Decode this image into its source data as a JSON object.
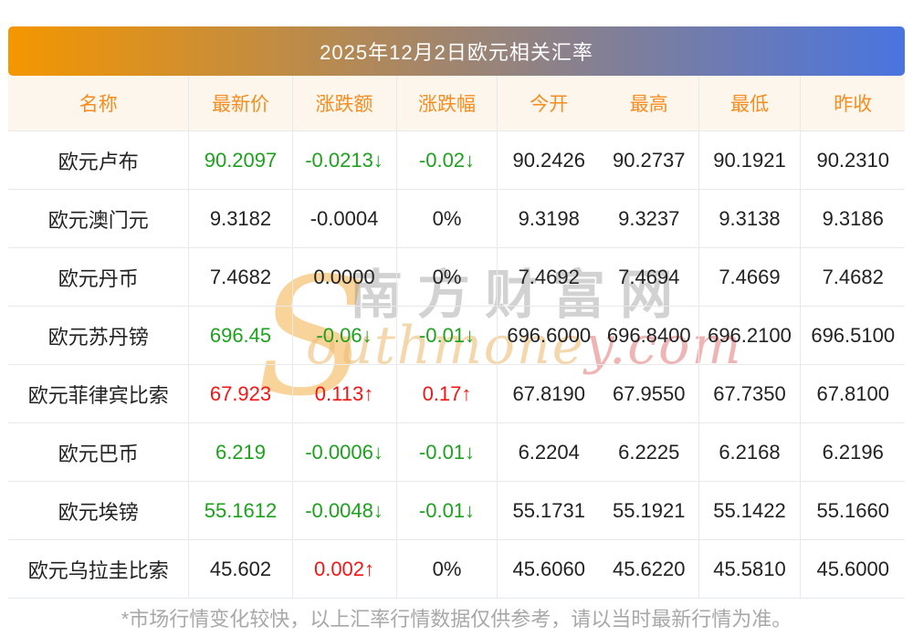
{
  "banner": {
    "title": "2025年12月2日欧元相关汇率"
  },
  "columns": {
    "name": "名称",
    "latest": "最新价",
    "change": "涨跌额",
    "change_pct": "涨跌幅",
    "open": "今开",
    "high": "最高",
    "low": "最低",
    "prev_close": "昨收"
  },
  "rows": [
    {
      "name": "欧元卢布",
      "latest": "90.2097",
      "latest_cls": "down",
      "change": "-0.0213↓",
      "change_cls": "down",
      "pct": "-0.02↓",
      "pct_cls": "down",
      "open": "90.2426",
      "high": "90.2737",
      "low": "90.1921",
      "prev": "90.2310"
    },
    {
      "name": "欧元澳门元",
      "latest": "9.3182",
      "latest_cls": "flat",
      "change": "-0.0004",
      "change_cls": "flat",
      "pct": "0%",
      "pct_cls": "flat",
      "open": "9.3198",
      "high": "9.3237",
      "low": "9.3138",
      "prev": "9.3186"
    },
    {
      "name": "欧元丹币",
      "latest": "7.4682",
      "latest_cls": "flat",
      "change": "0.0000",
      "change_cls": "flat",
      "pct": "0%",
      "pct_cls": "flat",
      "open": "7.4692",
      "high": "7.4694",
      "low": "7.4669",
      "prev": "7.4682"
    },
    {
      "name": "欧元苏丹镑",
      "latest": "696.45",
      "latest_cls": "down",
      "change": "-0.06↓",
      "change_cls": "down",
      "pct": "-0.01↓",
      "pct_cls": "down",
      "open": "696.6000",
      "high": "696.8400",
      "low": "696.2100",
      "prev": "696.5100"
    },
    {
      "name": "欧元菲律宾比索",
      "latest": "67.923",
      "latest_cls": "up",
      "change": "0.113↑",
      "change_cls": "up",
      "pct": "0.17↑",
      "pct_cls": "up",
      "open": "67.8190",
      "high": "67.9550",
      "low": "67.7350",
      "prev": "67.8100"
    },
    {
      "name": "欧元巴币",
      "latest": "6.219",
      "latest_cls": "down",
      "change": "-0.0006↓",
      "change_cls": "down",
      "pct": "-0.01↓",
      "pct_cls": "down",
      "open": "6.2204",
      "high": "6.2225",
      "low": "6.2168",
      "prev": "6.2196"
    },
    {
      "name": "欧元埃镑",
      "latest": "55.1612",
      "latest_cls": "down",
      "change": "-0.0048↓",
      "change_cls": "down",
      "pct": "-0.01↓",
      "pct_cls": "down",
      "open": "55.1731",
      "high": "55.1921",
      "low": "55.1422",
      "prev": "55.1660"
    },
    {
      "name": "欧元乌拉圭比索",
      "latest": "45.602",
      "latest_cls": "flat",
      "change": "0.002↑",
      "change_cls": "up",
      "pct": "0%",
      "pct_cls": "flat",
      "open": "45.6060",
      "high": "45.6220",
      "low": "45.5810",
      "prev": "45.6000"
    }
  ],
  "watermark": {
    "s": "S",
    "cn": "南方财富网",
    "en_a": "outhmone",
    "en_b": "y.com"
  },
  "footer": {
    "disclaimer": "*市场行情变化较快，以上汇率行情数据仅供参考，请以当时最新行情为准。"
  },
  "colors": {
    "banner_gradient_left": "#f49600",
    "banner_gradient_right": "#4a74e0",
    "header_text": "#f78c1f",
    "header_background": "#fdf6ed",
    "up_red": "#f51515",
    "down_green": "#1ca21c",
    "neutral_text": "#222222",
    "divider": "#e9e9e9",
    "disclaimer_gray": "#a8a8a8"
  }
}
